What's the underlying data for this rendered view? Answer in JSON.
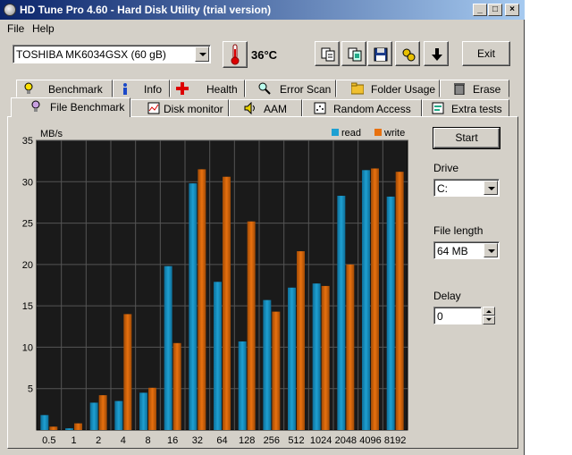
{
  "window": {
    "title": "HD Tune Pro 4.60 - Hard Disk Utility (trial version)",
    "controls": {
      "minimize": "_",
      "maximize": "□",
      "close": "×"
    }
  },
  "menu": {
    "file": "File",
    "help": "Help"
  },
  "toolbar": {
    "drive_select": "TOSHIBA MK6034GSX (60 gB)",
    "temperature": "36°C",
    "exit_label": "Exit",
    "icons": [
      "copy-text-icon",
      "copy-screen-icon",
      "save-icon",
      "options-icon",
      "down-arrow-icon"
    ]
  },
  "tabs": {
    "row1": [
      "Benchmark",
      "Info",
      "Health",
      "Error Scan",
      "Folder Usage",
      "Erase"
    ],
    "row2": [
      "File Benchmark",
      "Disk monitor",
      "AAM",
      "Random Access",
      "Extra tests"
    ],
    "active": "File Benchmark"
  },
  "controls": {
    "start_label": "Start",
    "drive_label": "Drive",
    "drive_value": "C:",
    "file_length_label": "File length",
    "file_length_value": "64 MB",
    "delay_label": "Delay",
    "delay_value": "0"
  },
  "chart_data": {
    "type": "bar",
    "ylabel": "MB/s",
    "ylim": [
      0,
      35
    ],
    "yticks": [
      5,
      10,
      15,
      20,
      25,
      30,
      35
    ],
    "categories": [
      "0.5",
      "1",
      "2",
      "4",
      "8",
      "16",
      "32",
      "64",
      "128",
      "256",
      "512",
      "1024",
      "2048",
      "4096",
      "8192"
    ],
    "series": [
      {
        "name": "read",
        "color": "#1ea0d2",
        "values": [
          1.8,
          0.2,
          3.3,
          3.5,
          4.5,
          19.8,
          29.8,
          17.9,
          10.7,
          15.7,
          17.2,
          17.7,
          28.3,
          31.4,
          28.2
        ]
      },
      {
        "name": "write",
        "color": "#e8710f",
        "values": [
          0.4,
          0.8,
          4.2,
          14.0,
          5.1,
          10.5,
          31.5,
          30.6,
          25.2,
          14.3,
          21.6,
          17.4,
          20.0,
          31.6,
          31.2
        ]
      }
    ],
    "grid": true,
    "legend": "top-right",
    "background": "#1a1a1a"
  }
}
